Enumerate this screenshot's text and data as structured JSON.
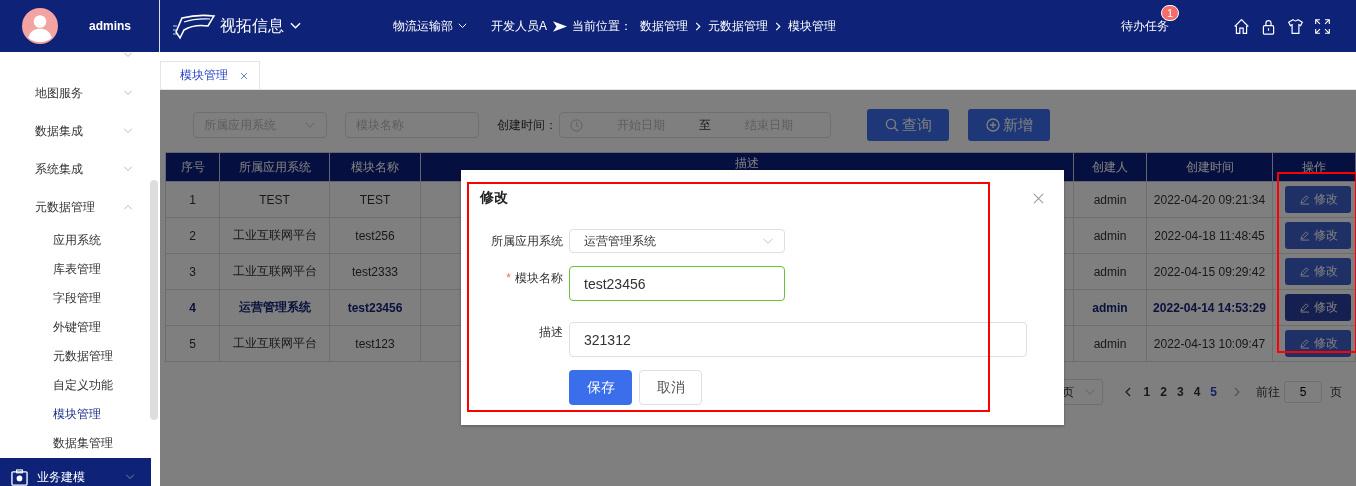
{
  "header": {
    "user_name": "admins",
    "brand": "视拓信息",
    "department": "物流运输部",
    "role": "开发人员A",
    "location_label": "当前位置：",
    "breadcrumb": [
      "数据管理",
      "元数据管理",
      "模块管理"
    ],
    "todo": {
      "label": "待办任务",
      "badge": "1"
    }
  },
  "sidebar": {
    "items": [
      {
        "expanded": false
      },
      {
        "label": "地图服务",
        "expanded": false
      },
      {
        "label": "数据集成",
        "expanded": false
      },
      {
        "label": "系统集成",
        "expanded": false
      },
      {
        "label": "元数据管理",
        "expanded": true,
        "children": [
          {
            "label": "应用系统",
            "selected": false
          },
          {
            "label": "库表管理",
            "selected": false
          },
          {
            "label": "字段管理",
            "selected": false
          },
          {
            "label": "外键管理",
            "selected": false
          },
          {
            "label": "元数据管理",
            "selected": false
          },
          {
            "label": "自定义功能",
            "selected": false
          },
          {
            "label": "模块管理",
            "selected": true
          },
          {
            "label": "数据集管理",
            "selected": false
          }
        ]
      }
    ],
    "section": {
      "label": "业务建模",
      "expanded": false
    }
  },
  "tabs": [
    {
      "label": "模块管理",
      "selected": true
    }
  ],
  "filters": {
    "system": {
      "placeholder": "所属应用系统"
    },
    "module": {
      "placeholder": "模块名称"
    },
    "created_label": "创建时间：",
    "date_start": {
      "placeholder": "开始日期"
    },
    "date_separator": "至",
    "date_end": {
      "placeholder": "结束日期"
    },
    "buttons": [
      {
        "label": "查询",
        "kind": "search"
      },
      {
        "label": "新增",
        "kind": "add"
      }
    ]
  },
  "table": {
    "columns": [
      "序号",
      "所属应用系统",
      "模块名称",
      "描述",
      "创建人",
      "创建时间",
      "操作"
    ],
    "rows": [
      {
        "index": "1",
        "system": "TEST",
        "module": "TEST",
        "creator": "admin",
        "created": "2022-04-20 09:21:34",
        "action": "修改",
        "selected": false
      },
      {
        "index": "2",
        "system": "工业互联网平台",
        "module": "test256",
        "creator": "admin",
        "created": "2022-04-18 11:48:45",
        "action": "修改",
        "selected": false
      },
      {
        "index": "3",
        "system": "工业互联网平台",
        "module": "test2333",
        "creator": "admin",
        "created": "2022-04-15 09:29:42",
        "action": "修改",
        "selected": false
      },
      {
        "index": "4",
        "system": "运营管理系统",
        "module": "test23456",
        "creator": "admin",
        "created": "2022-04-14 14:53:29",
        "action": "修改",
        "selected": true
      },
      {
        "index": "5",
        "system": "工业互联网平台",
        "module": "test123",
        "creator": "admin",
        "created": "2022-04-13 10:09:47",
        "action": "修改",
        "selected": false
      }
    ]
  },
  "pagination": {
    "page_size": "页",
    "pages": [
      {
        "label": "1",
        "selected": false
      },
      {
        "label": "2",
        "selected": false
      },
      {
        "label": "3",
        "selected": false
      },
      {
        "label": "4",
        "selected": false
      },
      {
        "label": "5",
        "selected": true
      }
    ],
    "goto_label": "前往",
    "goto_value": "5",
    "goto_suffix": "页"
  },
  "dialog": {
    "title": "修改",
    "fields": [
      {
        "label": "所属应用系统",
        "kind": "select",
        "value": "运营管理系统"
      },
      {
        "label": "模块名称",
        "kind": "input",
        "value": "test23456",
        "required_mark": "*",
        "valid": true
      },
      {
        "label": "描述",
        "kind": "wide-input",
        "value": "321312",
        "valid": false
      }
    ],
    "buttons": [
      {
        "label": "保存",
        "kind": "primary"
      },
      {
        "label": "取消",
        "kind": "default"
      }
    ]
  }
}
